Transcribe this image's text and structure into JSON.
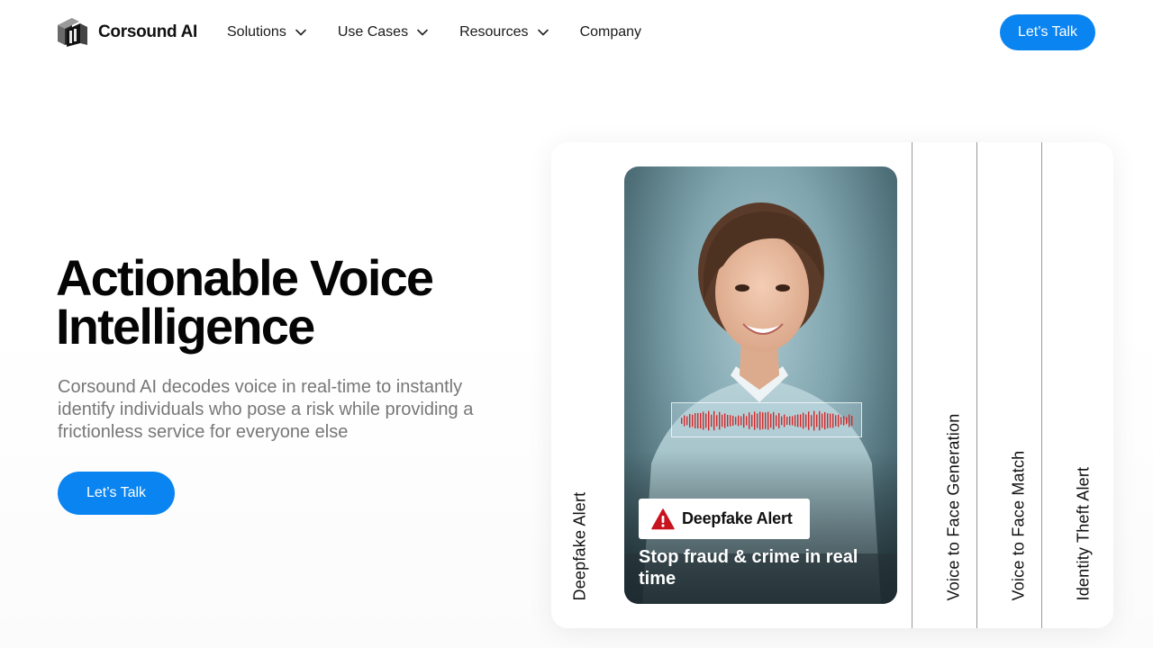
{
  "header": {
    "brand": "Corsound AI",
    "nav": [
      {
        "label": "Solutions",
        "has_dropdown": true
      },
      {
        "label": "Use Cases",
        "has_dropdown": true
      },
      {
        "label": "Resources",
        "has_dropdown": true
      },
      {
        "label": "Company",
        "has_dropdown": false
      }
    ],
    "cta_label": "Let’s Talk"
  },
  "hero": {
    "title_line1": "Actionable Voice",
    "title_line2": "Intelligence",
    "subtitle": "Corsound AI decodes voice in real-time to instantly identify individuals who pose a risk while providing a frictionless service for everyone else",
    "cta_label": "Let’s Talk"
  },
  "features": {
    "tabs": [
      {
        "label": "Deepfake Alert",
        "active": true
      },
      {
        "label": "Voice to Face Generation",
        "active": false
      },
      {
        "label": "Voice to Face Match",
        "active": false
      },
      {
        "label": "Identity Theft Alert",
        "active": false
      }
    ],
    "active_card": {
      "badge_label": "Deepfake Alert",
      "badge_icon": "warning-triangle-icon",
      "caption": "Stop fraud & crime in real time"
    }
  },
  "colors": {
    "accent": "#0a84f0",
    "alert_red": "#c8141e",
    "waveform_red": "#d22a2a"
  }
}
